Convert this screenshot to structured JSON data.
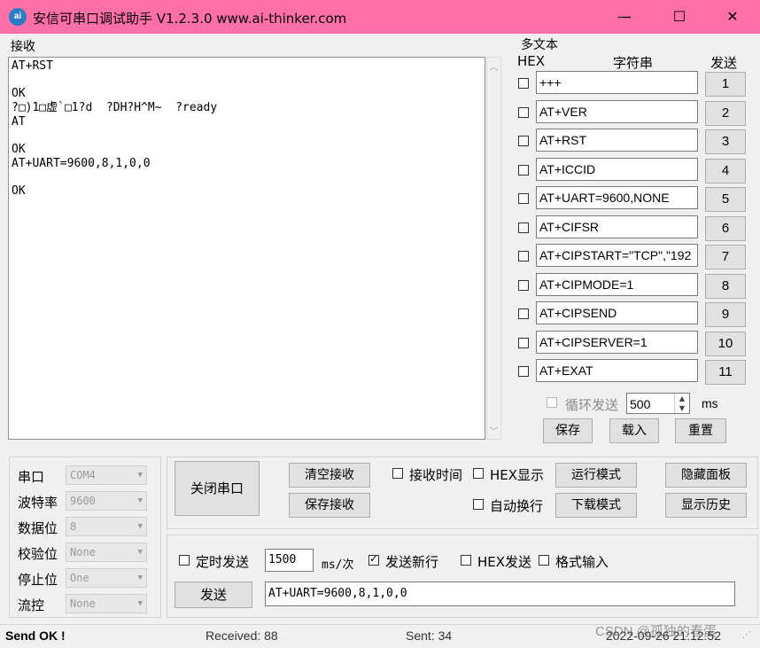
{
  "titlebar": {
    "icon_text": "ai",
    "title": "安信可串口调试助手 V1.2.3.0    www.ai-thinker.com",
    "minimize": "—",
    "maximize": "☐",
    "close": "✕"
  },
  "receive": {
    "label": "接收",
    "text": "AT+RST\n\nOK\n?□)1□虚`□1?d  ?DH?H^M~  ?ready\nAT\n\nOK\nAT+UART=9600,8,1,0,0\n\nOK"
  },
  "multi": {
    "label": "多文本",
    "hex_header": "HEX",
    "string_header": "字符串",
    "send_header": "发送",
    "rows": [
      {
        "text": "+++",
        "btn": "1"
      },
      {
        "text": "AT+VER",
        "btn": "2"
      },
      {
        "text": "AT+RST",
        "btn": "3"
      },
      {
        "text": "AT+ICCID",
        "btn": "4"
      },
      {
        "text": "AT+UART=9600,NONE",
        "btn": "5"
      },
      {
        "text": "AT+CIFSR",
        "btn": "6"
      },
      {
        "text": "AT+CIPSTART=\"TCP\",\"192",
        "btn": "7"
      },
      {
        "text": "AT+CIPMODE=1",
        "btn": "8"
      },
      {
        "text": "AT+CIPSEND",
        "btn": "9"
      },
      {
        "text": "AT+CIPSERVER=1",
        "btn": "10"
      },
      {
        "text": "AT+EXAT",
        "btn": "11"
      }
    ],
    "loop_label": "循环发送",
    "loop_value": "500",
    "loop_unit": "ms",
    "save": "保存",
    "load": "载入",
    "reset": "重置"
  },
  "port": {
    "rows": [
      {
        "label": "串口",
        "value": "COM4"
      },
      {
        "label": "波特率",
        "value": "9600"
      },
      {
        "label": "数据位",
        "value": "8"
      },
      {
        "label": "校验位",
        "value": "None"
      },
      {
        "label": "停止位",
        "value": "One"
      },
      {
        "label": "流控",
        "value": "None"
      }
    ]
  },
  "controls": {
    "close_port": "关闭串口",
    "clear_recv": "清空接收",
    "save_recv": "保存接收",
    "recv_time": "接收时间",
    "hex_display": "HEX显示",
    "auto_newline": "自动换行",
    "run_mode": "运行模式",
    "download_mode": "下载模式",
    "hide_panel": "隐藏面板",
    "show_history": "显示历史"
  },
  "send": {
    "timed_send": "定时发送",
    "interval": "1500",
    "interval_unit": "ms/次",
    "send_newline": "发送新行",
    "hex_send": "HEX发送",
    "format_input": "格式输入",
    "send_button": "发送",
    "input": "AT+UART=9600,8,1,0,0"
  },
  "status": {
    "message": "Send OK !",
    "received": "Received: 88",
    "sent": "Sent: 34",
    "datetime": "2022-09-26 21:12:52",
    "watermark": "CSDN @孤独的春蛋"
  }
}
